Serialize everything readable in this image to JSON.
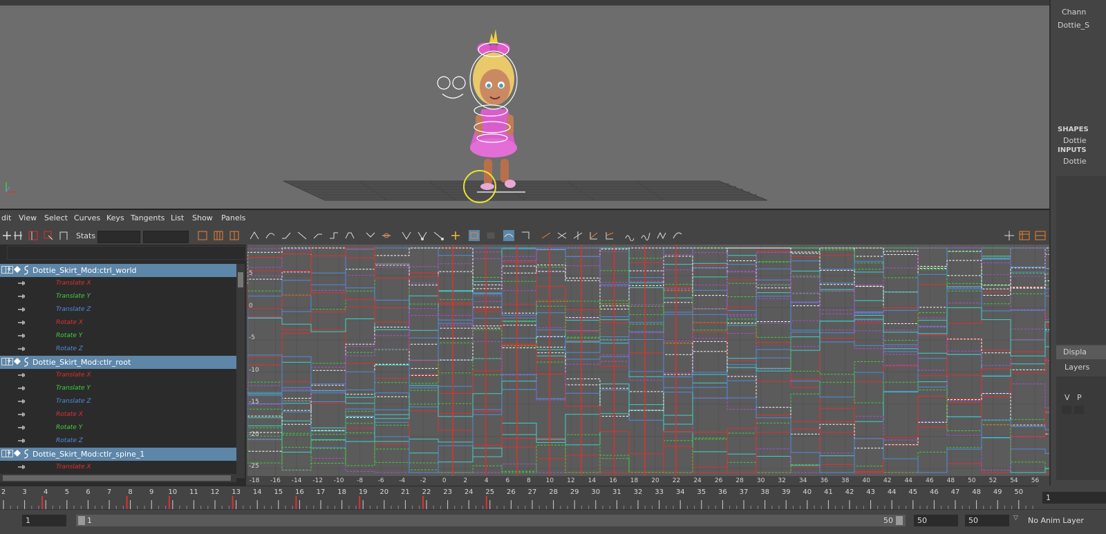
{
  "graph_editor": {
    "menu": [
      "dit",
      "View",
      "Select",
      "Curves",
      "Keys",
      "Tangents",
      "List",
      "Show",
      "Panels"
    ],
    "stats_label": "Stats",
    "y_ticks": [
      "5",
      "0",
      "-5",
      "-10",
      "-15",
      "-20",
      "-25"
    ],
    "x_ticks": [
      "-18",
      "-16",
      "-14",
      "-12",
      "-10",
      "-8",
      "-6",
      "-4",
      "-2",
      "0",
      "2",
      "4",
      "6",
      "8",
      "10",
      "12",
      "14",
      "16",
      "18",
      "20",
      "22",
      "24",
      "26",
      "28",
      "30",
      "32",
      "34",
      "36",
      "38",
      "40",
      "42",
      "44",
      "46",
      "48",
      "50",
      "52",
      "54",
      "56"
    ]
  },
  "outliner": {
    "nodes": [
      {
        "label": "Dottie_Skirt_Mod:ctrl_world",
        "attrs": [
          {
            "label": "Translate X",
            "color": "#e0312f"
          },
          {
            "label": "Translate Y",
            "color": "#3fd13f"
          },
          {
            "label": "Translate Z",
            "color": "#4e8ddf"
          },
          {
            "label": "Rotate X",
            "color": "#e0312f"
          },
          {
            "label": "Rotate Y",
            "color": "#3fd13f"
          },
          {
            "label": "Rotate Z",
            "color": "#4e8ddf"
          }
        ]
      },
      {
        "label": "Dottie_Skirt_Mod:ctlr_root",
        "attrs": [
          {
            "label": "Translate X",
            "color": "#e0312f"
          },
          {
            "label": "Translate Y",
            "color": "#3fd13f"
          },
          {
            "label": "Translate Z",
            "color": "#4e8ddf"
          },
          {
            "label": "Rotate X",
            "color": "#e0312f"
          },
          {
            "label": "Rotate Y",
            "color": "#3fd13f"
          },
          {
            "label": "Rotate Z",
            "color": "#4e8ddf"
          }
        ]
      },
      {
        "label": "Dottie_Skirt_Mod:ctlr_spine_1",
        "attrs": [
          {
            "label": "Translate X",
            "color": "#e0312f"
          }
        ]
      }
    ]
  },
  "channel_box": {
    "channels_label": "Chann",
    "object_name": "Dottie_S",
    "shapes_label": "SHAPES",
    "shapes_item": "Dottie",
    "inputs_label": "INPUTS",
    "inputs_item": "Dottie",
    "display_tab": "Displa",
    "layers_label": "Layers",
    "v_col": "V",
    "p_col": "P"
  },
  "timeline": {
    "frames": [
      "2",
      "3",
      "4",
      "5",
      "6",
      "7",
      "8",
      "9",
      "10",
      "11",
      "12",
      "13",
      "14",
      "15",
      "16",
      "17",
      "18",
      "19",
      "20",
      "21",
      "22",
      "23",
      "24",
      "25",
      "26",
      "27",
      "28",
      "29",
      "30",
      "31",
      "32",
      "33",
      "34",
      "35",
      "36",
      "37",
      "38",
      "39",
      "40",
      "41",
      "42",
      "43",
      "44",
      "45",
      "46",
      "47",
      "48",
      "49",
      "50"
    ],
    "key_frames": [
      4,
      8,
      10,
      13,
      16,
      19,
      22,
      25
    ],
    "current_frame": "1"
  },
  "range": {
    "start": "1",
    "range_start": "1",
    "range_end": "50",
    "end": "50",
    "end2": "50",
    "anim_layer": "No Anim Layer"
  },
  "colors": {
    "red": "#e0312f",
    "green": "#3fd13f",
    "blue": "#4e8ddf",
    "node_highlight": "#5d86a8"
  }
}
